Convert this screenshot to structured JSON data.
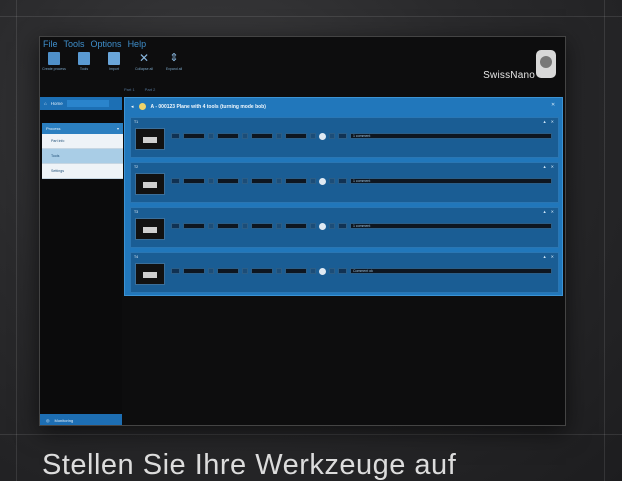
{
  "menu": [
    "File",
    "Tools",
    "Options",
    "Help"
  ],
  "toolbar": [
    {
      "label": "Create process",
      "icon": "document-icon",
      "color": "#4f90c9"
    },
    {
      "label": "Tools",
      "icon": "tools-icon",
      "color": "#5a9ad2"
    },
    {
      "label": "Import",
      "icon": "import-icon",
      "color": "#6aa6da"
    },
    {
      "label": "Collapse all",
      "icon": "collapse-icon",
      "color": "#8ab8e0"
    },
    {
      "label": "Expand all",
      "icon": "expand-icon",
      "color": "#8ab8e0"
    }
  ],
  "brand": {
    "name": "SwissNano"
  },
  "tabs": [
    "Part 1",
    "Part 2"
  ],
  "sidebar": {
    "header": "Home",
    "group_title": "Process",
    "items": [
      "Part info",
      "Tools",
      "Settings"
    ],
    "footer": "Monitoring"
  },
  "panel": {
    "title": "A - 000123  Plane with 4 tools (turning mode bob)",
    "tools": [
      {
        "label": "T1",
        "comment": "1 comment"
      },
      {
        "label": "T2",
        "comment": "1 comment"
      },
      {
        "label": "T3",
        "comment": "1 comment"
      },
      {
        "label": "T4",
        "comment": "Comment ok"
      }
    ]
  },
  "caption": "Stellen Sie Ihre Werkzeuge auf",
  "colors": {
    "accent": "#2177bb",
    "panel_dark": "#1a5d94",
    "menu": "#3f8fcc"
  }
}
